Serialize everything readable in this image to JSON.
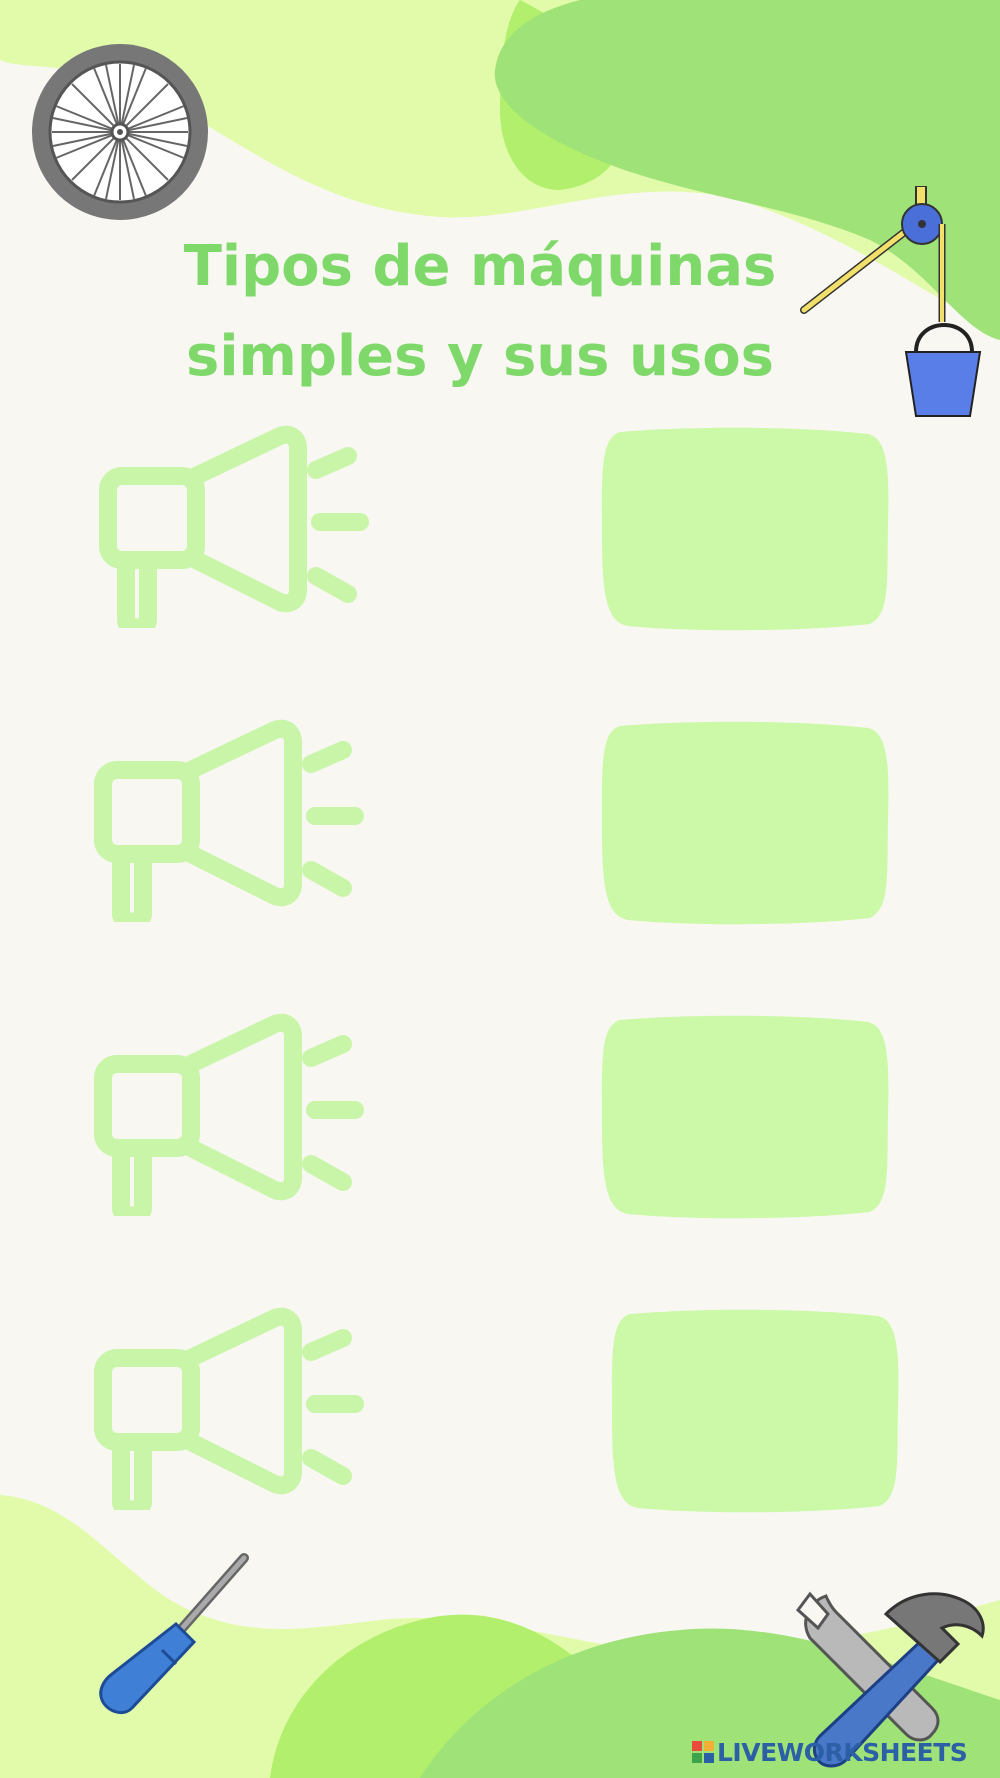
{
  "worksheet": {
    "title_line1": "Tipos de máquinas",
    "title_line2": "simples y sus usos"
  },
  "speakers": [
    {
      "icon": "megaphone-icon",
      "color": "#c8f5a8"
    },
    {
      "icon": "megaphone-icon",
      "color": "#c8f5a8"
    },
    {
      "icon": "megaphone-icon",
      "color": "#c8f5a8"
    },
    {
      "icon": "megaphone-icon",
      "color": "#c8f5a8"
    }
  ],
  "answer_boxes": [
    {
      "color": "#ccf9a8"
    },
    {
      "color": "#ccf9a8"
    },
    {
      "color": "#ccf9a8"
    },
    {
      "color": "#ccf9a8"
    }
  ],
  "decorations": [
    "wheel-icon",
    "pulley-icon",
    "screwdriver-icon",
    "tools-icon"
  ],
  "colors": {
    "background": "#f8f7f2",
    "title": "#7fd96a",
    "blob_light": "#e2fbaa",
    "blob_mid": "#b1ef6c",
    "blob_dark": "#9fe278"
  },
  "footer": {
    "brand": "LIVEWORKSHEETS"
  }
}
